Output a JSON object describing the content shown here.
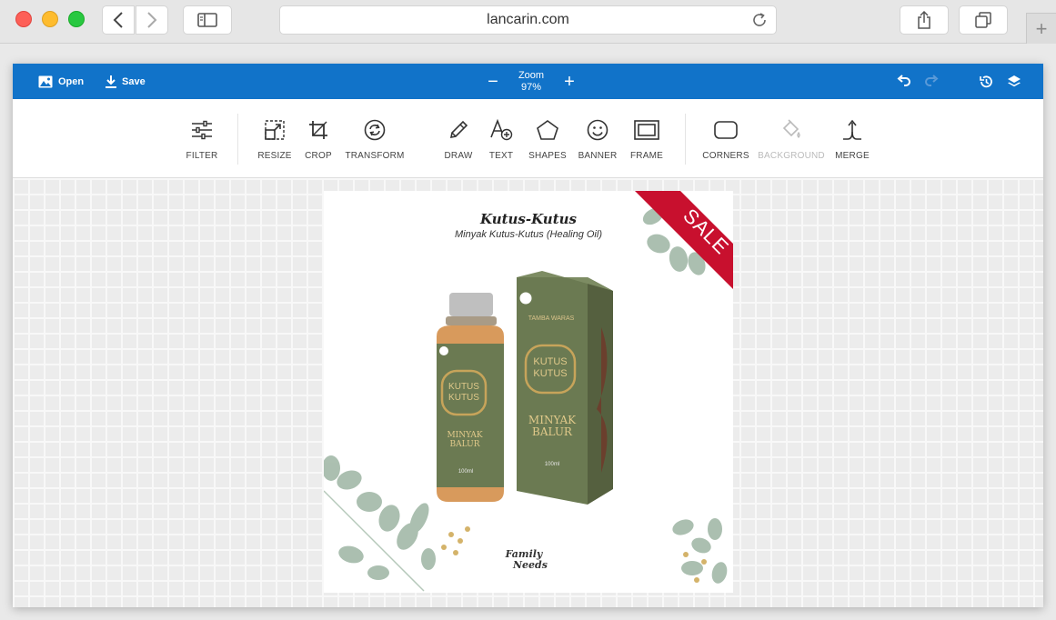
{
  "browser": {
    "url": "lancarin.com"
  },
  "topbar": {
    "open_label": "Open",
    "save_label": "Save",
    "zoom_label": "Zoom",
    "zoom_value": "97%"
  },
  "tools": [
    {
      "label": "FILTER",
      "icon": "filter-icon"
    },
    {
      "label": "RESIZE",
      "icon": "resize-icon"
    },
    {
      "label": "CROP",
      "icon": "crop-icon"
    },
    {
      "label": "TRANSFORM",
      "icon": "transform-icon"
    },
    {
      "label": "DRAW",
      "icon": "pencil-icon"
    },
    {
      "label": "TEXT",
      "icon": "text-icon"
    },
    {
      "label": "SHAPES",
      "icon": "pentagon-icon"
    },
    {
      "label": "BANNER",
      "icon": "smiley-icon"
    },
    {
      "label": "FRAME",
      "icon": "frame-icon"
    },
    {
      "label": "CORNERS",
      "icon": "rounded-rect-icon"
    },
    {
      "label": "BACKGROUND",
      "icon": "paint-bucket-icon",
      "disabled": true
    },
    {
      "label": "MERGE",
      "icon": "merge-icon"
    }
  ],
  "image": {
    "title": "Kutus-Kutus",
    "subtitle": "Minyak Kutus-Kutus (Healing Oil)",
    "sale_ribbon": "SALE",
    "box_brand_top": "TAMBA WARAS",
    "box_logo": "KUTUS KUTUS",
    "box_product": "MINYAK BALUR",
    "bottle_logo": "KUTUS KUTUS",
    "bottle_product": "MINYAK BALUR",
    "volume": "100ml",
    "footer_logo_line1": "Family",
    "footer_logo_line2": "Needs"
  },
  "colors": {
    "accent": "#1173c9",
    "sale_red": "#c8102e",
    "product_green": "#6b7a52"
  }
}
